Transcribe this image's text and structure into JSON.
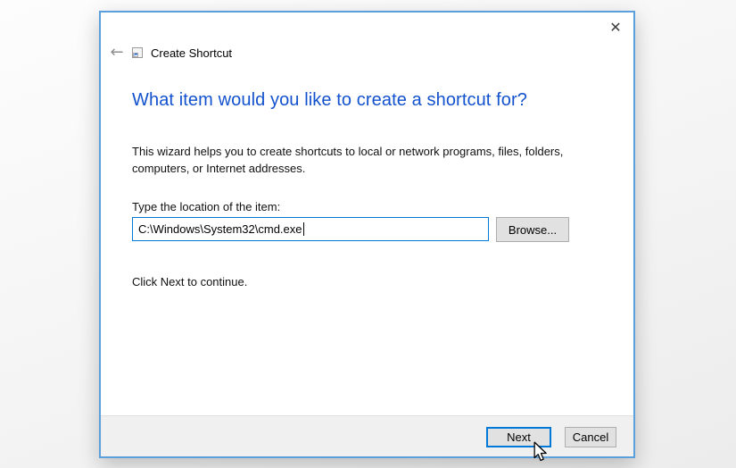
{
  "window": {
    "title": "Create Shortcut"
  },
  "icons": {
    "close": "✕",
    "back": "←"
  },
  "wizard": {
    "heading": "What item would you like to create a shortcut for?",
    "description_lines": [
      "This wizard helps you to create shortcuts to local or network programs, files, folders,",
      "computers, or Internet addresses."
    ],
    "location_label": "Type the location of the item:",
    "location_value": "C:\\Windows\\System32\\cmd.exe",
    "browse_label": "Browse...",
    "hint": "Click Next to continue.",
    "buttons": {
      "next": "Next",
      "cancel": "Cancel"
    }
  },
  "colors": {
    "accent": "#0078d7",
    "heading_text": "#1352ce",
    "window_border": "#5b9fdd",
    "footer_bg": "#f0f0f0",
    "button_bg": "#e1e1e1",
    "button_border": "#adadad"
  }
}
